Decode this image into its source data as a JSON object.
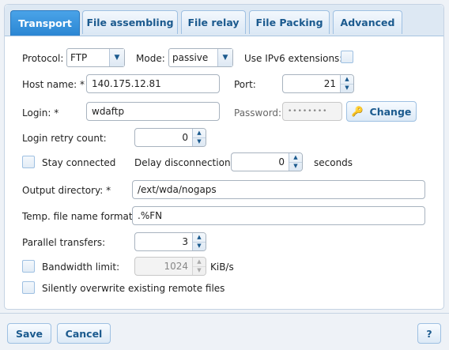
{
  "tabs": [
    {
      "label": "Transport"
    },
    {
      "label": "File assembling"
    },
    {
      "label": "File relay"
    },
    {
      "label": "File Packing"
    },
    {
      "label": "Advanced"
    }
  ],
  "form": {
    "protocol_label": "Protocol:",
    "protocol_value": "FTP",
    "mode_label": "Mode:",
    "mode_value": "passive",
    "ipv6_label": "Use IPv6 extensions:",
    "host_label": "Host name: *",
    "host_value": "140.175.12.81",
    "port_label": "Port:",
    "port_value": "21",
    "login_label": "Login: *",
    "login_value": "wdaftp",
    "password_label": "Password:",
    "password_value": "••••••••",
    "change_label": "Change",
    "retry_label": "Login retry count:",
    "retry_value": "0",
    "stay_label": "Stay connected",
    "delay_label": "Delay disconnection:",
    "delay_value": "0",
    "seconds_label": "seconds",
    "outdir_label": "Output directory: *",
    "outdir_value": "/ext/wda/nogaps",
    "temp_label": "Temp. file name format:",
    "temp_value": ".%FN",
    "parallel_label": "Parallel transfers:",
    "parallel_value": "3",
    "bandwidth_label": "Bandwidth limit:",
    "bandwidth_value": "1024",
    "bandwidth_unit": "KiB/s",
    "overwrite_label": "Silently overwrite existing remote files"
  },
  "footer": {
    "save_label": "Save",
    "cancel_label": "Cancel",
    "help_label": "?"
  }
}
